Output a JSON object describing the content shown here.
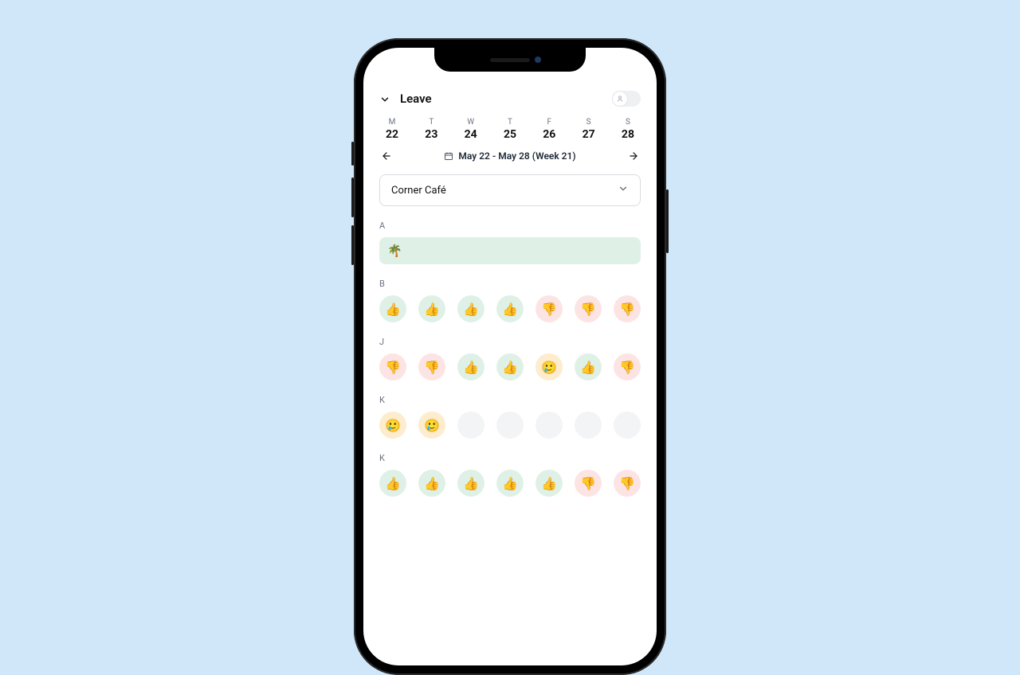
{
  "header": {
    "title": "Leave"
  },
  "week": {
    "days": [
      {
        "letter": "M",
        "num": "22"
      },
      {
        "letter": "T",
        "num": "23"
      },
      {
        "letter": "W",
        "num": "24"
      },
      {
        "letter": "T",
        "num": "25"
      },
      {
        "letter": "F",
        "num": "26"
      },
      {
        "letter": "S",
        "num": "27"
      },
      {
        "letter": "S",
        "num": "28"
      }
    ],
    "range_label": "May 22 - May 28 (Week 21)"
  },
  "location_dropdown": {
    "selected": "Corner Café"
  },
  "sections": [
    {
      "letter": "A",
      "type": "leave",
      "leave_emoji": "🌴"
    },
    {
      "letter": "B",
      "type": "row",
      "cells": [
        "up",
        "up",
        "up",
        "up",
        "down",
        "down",
        "down"
      ]
    },
    {
      "letter": "J",
      "type": "row",
      "cells": [
        "down",
        "down",
        "up",
        "up",
        "maybe",
        "up",
        "down"
      ]
    },
    {
      "letter": "K",
      "type": "row",
      "cells": [
        "maybe",
        "maybe",
        "empty",
        "empty",
        "empty",
        "empty",
        "empty"
      ]
    },
    {
      "letter": "K",
      "type": "row",
      "cells": [
        "up",
        "up",
        "up",
        "up",
        "up",
        "down",
        "down"
      ]
    }
  ],
  "emoji": {
    "up": "👍",
    "down": "👎",
    "maybe": "🥲",
    "empty": ""
  }
}
